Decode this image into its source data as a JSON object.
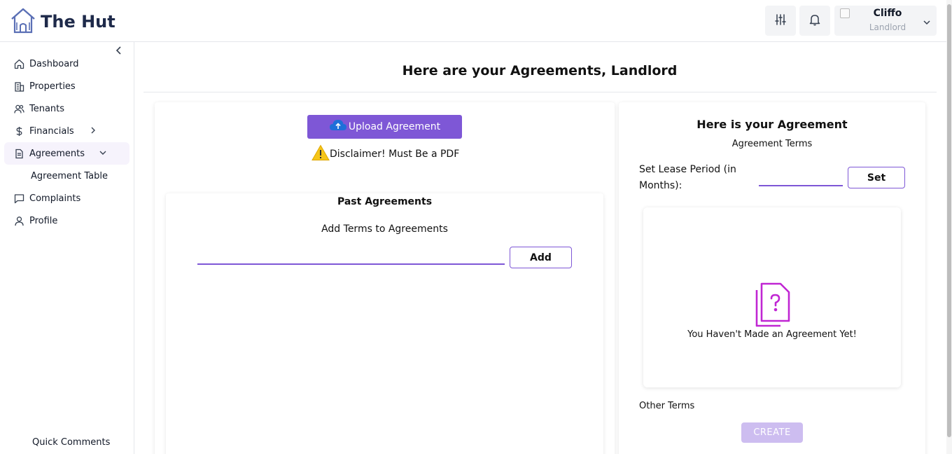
{
  "brand": {
    "name": "The Hut",
    "accent": "#7e57d6",
    "dark": "#1e2a4a"
  },
  "header": {
    "user": {
      "name": "Cliffo",
      "role": "Landlord"
    }
  },
  "sidebar": {
    "items": [
      {
        "label": "Dashboard",
        "icon": "home-icon"
      },
      {
        "label": "Properties",
        "icon": "building-icon"
      },
      {
        "label": "Tenants",
        "icon": "users-icon"
      },
      {
        "label": "Financials",
        "icon": "dollar-icon"
      },
      {
        "label": "Agreements",
        "icon": "document-icon"
      },
      {
        "label": "Complaints",
        "icon": "message-icon"
      },
      {
        "label": "Profile",
        "icon": "user-icon"
      }
    ],
    "sub_items": [
      {
        "label": "Agreement Table"
      }
    ],
    "footer": "Quick Comments"
  },
  "main": {
    "title": "Here are your Agreements, Landlord",
    "left": {
      "upload_label": "Upload Agreement",
      "disclaimer": "Disclaimer! Must Be a PDF",
      "past_title": "Past Agreements",
      "terms_label": "Add Terms to Agreements",
      "terms_value": "",
      "add_label": "Add"
    },
    "right": {
      "title": "Here is your Agreement",
      "subtitle": "Agreement Terms",
      "lease_label": "Set Lease Period (in Months):",
      "lease_value": "",
      "set_label": "Set",
      "empty_text": "You Haven't Made an Agreement Yet!",
      "other_terms": "Other Terms",
      "create_label": "CREATE"
    }
  }
}
